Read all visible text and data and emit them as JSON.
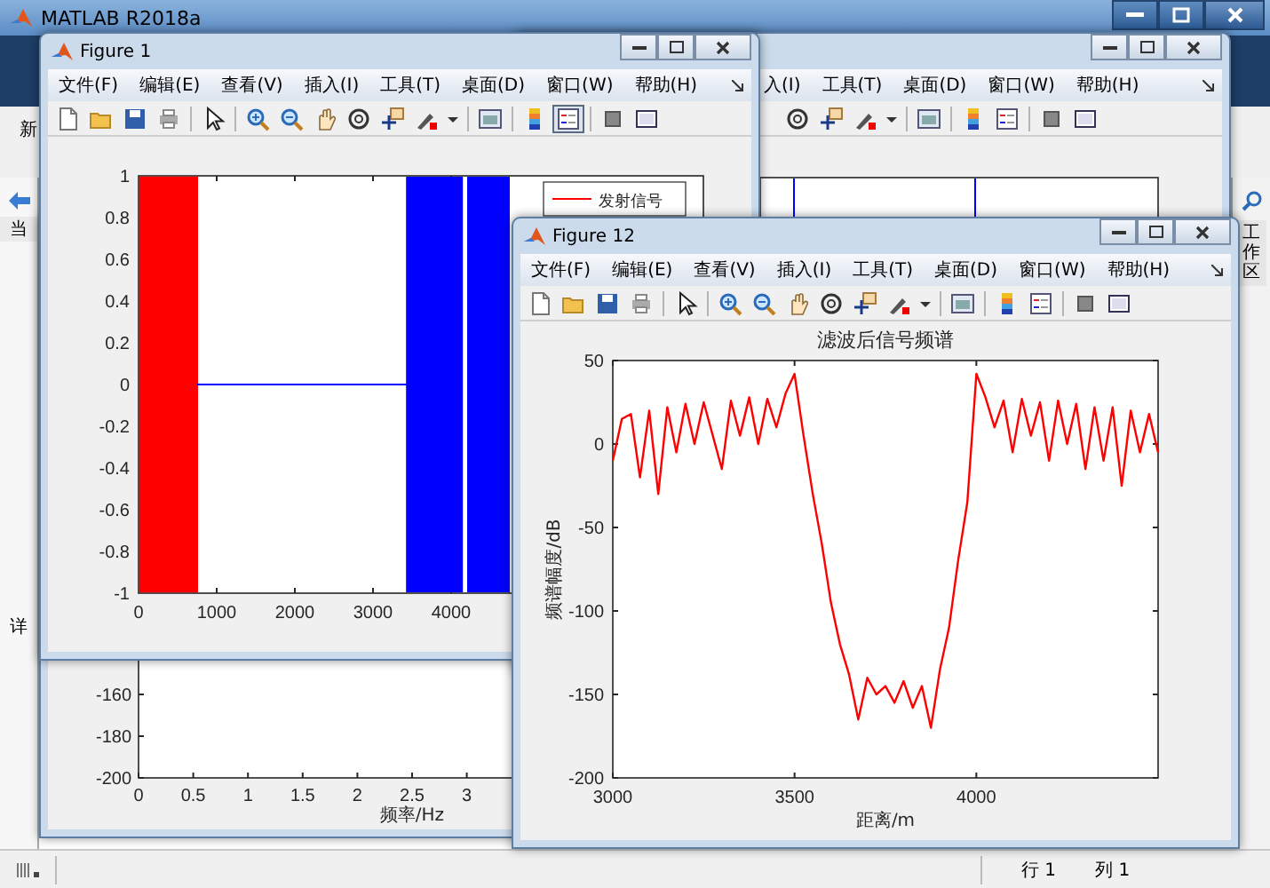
{
  "main_window": {
    "title": "MATLAB R2018a",
    "toolstrip_label": "新",
    "file_panel_label": "当",
    "details_label": "详",
    "workspace_tab": "工作区",
    "status_bar": {
      "row": "行 1",
      "column": "列 1"
    }
  },
  "background_figure_lower": {
    "y_tick_labels": [
      "-160",
      "-180",
      "-200"
    ],
    "x_tick_labels": [
      "0",
      "0.5",
      "1",
      "1.5",
      "2",
      "2.5",
      "3"
    ],
    "xlabel": "频率/Hz"
  },
  "background_figure_upper": {
    "menu": [
      "入(I)",
      "工具(T)",
      "桌面(D)",
      "窗口(W)",
      "帮助(H)"
    ],
    "legend_toggle_on": false
  },
  "figure_1": {
    "title": "Figure 1",
    "menu": [
      "文件(F)",
      "编辑(E)",
      "查看(V)",
      "插入(I)",
      "工具(T)",
      "桌面(D)",
      "窗口(W)",
      "帮助(H)"
    ],
    "legend_toggle_on": true,
    "y_tick_labels": [
      "1",
      "0.8",
      "0.6",
      "0.4",
      "0.2",
      "0",
      "-0.2",
      "-0.4",
      "-0.6",
      "-0.8",
      "-1"
    ],
    "x_tick_labels": [
      "0",
      "1000",
      "2000",
      "3000",
      "4000"
    ],
    "legend": [
      "发射信号"
    ]
  },
  "figure_12": {
    "title": "Figure 12",
    "menu": [
      "文件(F)",
      "编辑(E)",
      "查看(V)",
      "插入(I)",
      "工具(T)",
      "桌面(D)",
      "窗口(W)",
      "帮助(H)"
    ],
    "legend_toggle_on": false,
    "chart_data": {
      "type": "line",
      "title": "滤波后信号频谱",
      "xlabel": "距离/m",
      "ylabel": "频谱幅度/dB",
      "x": [
        3000,
        3025,
        3050,
        3075,
        3100,
        3125,
        3150,
        3175,
        3200,
        3225,
        3250,
        3275,
        3300,
        3325,
        3350,
        3375,
        3400,
        3425,
        3450,
        3475,
        3500,
        3525,
        3550,
        3575,
        3600,
        3625,
        3650,
        3675,
        3700,
        3725,
        3750,
        3775,
        3800,
        3825,
        3850,
        3875,
        3900,
        3925,
        3950,
        3975,
        4000,
        4025,
        4050,
        4075,
        4100,
        4125,
        4150,
        4175,
        4200,
        4225,
        4250,
        4275,
        4300,
        4325,
        4350,
        4375,
        4400,
        4425,
        4450,
        4475,
        4500
      ],
      "series": [
        {
          "color": "#ff0000",
          "values": [
            -10,
            15,
            18,
            -20,
            20,
            -30,
            22,
            -5,
            24,
            0,
            25,
            5,
            -15,
            26,
            5,
            28,
            0,
            27,
            10,
            30,
            42,
            5,
            -30,
            -60,
            -95,
            -120,
            -138,
            -165,
            -140,
            -150,
            -145,
            -155,
            -142,
            -158,
            -145,
            -170,
            -135,
            -110,
            -70,
            -35,
            42,
            28,
            10,
            26,
            -5,
            27,
            5,
            25,
            -10,
            26,
            0,
            24,
            -15,
            22,
            -10,
            22,
            -25,
            20,
            -5,
            18,
            -5
          ]
        }
      ],
      "xlim": [
        3000,
        4500
      ],
      "ylim": [
        -200,
        50
      ],
      "xticks": [
        3000,
        3500,
        4000
      ],
      "yticks": [
        -200,
        -150,
        -100,
        -50,
        0,
        50
      ]
    }
  }
}
